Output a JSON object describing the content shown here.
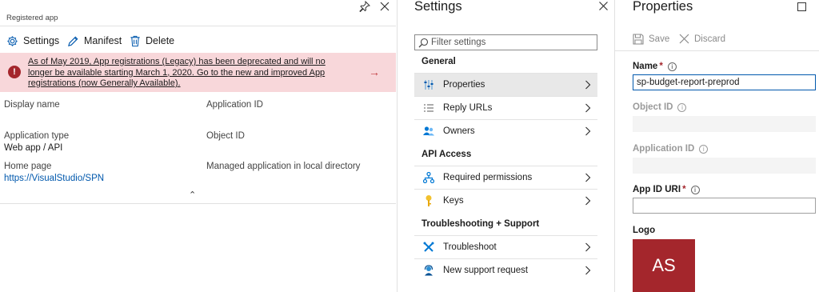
{
  "registered_app": {
    "subtitle": "Registered app",
    "commands": {
      "settings": "Settings",
      "manifest": "Manifest",
      "delete": "Delete"
    },
    "banner": {
      "text": "As of May 2019, App registrations (Legacy) has been deprecated and will no longer be available starting March 1, 2020. Go to the new and improved App registrations (now Generally Available).",
      "arrow": "→"
    },
    "props": {
      "display_name_label": "Display name",
      "application_id_label": "Application ID",
      "application_type_label": "Application type",
      "application_type_value": "Web app / API",
      "object_id_label": "Object ID",
      "home_page_label": "Home page",
      "home_page_value": "https://VisualStudio/SPN",
      "managed_app_label": "Managed application in local directory"
    },
    "collapse_glyph": "⌃"
  },
  "settings": {
    "title": "Settings",
    "filter_placeholder": "Filter settings",
    "sections": {
      "general": "General",
      "api_access": "API Access",
      "troubleshooting": "Troubleshooting + Support"
    },
    "items": {
      "properties": "Properties",
      "reply_urls": "Reply URLs",
      "owners": "Owners",
      "required_permissions": "Required permissions",
      "keys": "Keys",
      "troubleshoot": "Troubleshoot",
      "new_support_request": "New support request"
    }
  },
  "properties": {
    "title": "Properties",
    "save": "Save",
    "discard": "Discard",
    "name_label": "Name",
    "name_value": "sp-budget-report-preprod",
    "object_id_label": "Object ID",
    "application_id_label": "Application ID",
    "app_id_uri_label": "App ID URI",
    "logo_label": "Logo",
    "logo_initials": "AS",
    "required_mark": "*",
    "info_glyph": "i"
  },
  "colors": {
    "accent": "#0058ad",
    "banner_bg": "#f8d7da",
    "error": "#a4262c",
    "logo_bg": "#a4262c"
  }
}
